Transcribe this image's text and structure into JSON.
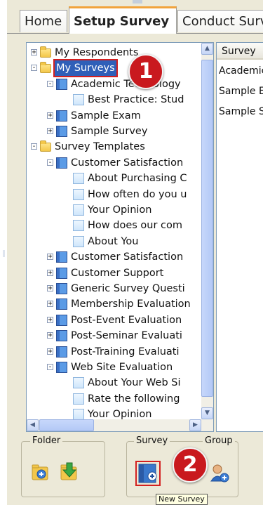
{
  "tabs": [
    {
      "label": "Home"
    },
    {
      "label": "Setup Survey"
    },
    {
      "label": "Conduct Surv"
    }
  ],
  "tree": {
    "nodes": [
      {
        "label": "My Respondents",
        "level": 0,
        "icon": "folder",
        "expander": "+"
      },
      {
        "label": "My Surveys",
        "level": 0,
        "icon": "folder",
        "expander": "-",
        "selected": true
      },
      {
        "label": "Academic Technology",
        "level": 1,
        "icon": "book",
        "expander": "-"
      },
      {
        "label": "Best Practice: Stud",
        "level": 2,
        "icon": "page",
        "expander": ""
      },
      {
        "label": "Sample Exam",
        "level": 1,
        "icon": "book",
        "expander": "+"
      },
      {
        "label": "Sample Survey",
        "level": 1,
        "icon": "book",
        "expander": "+"
      },
      {
        "label": "Survey Templates",
        "level": 0,
        "icon": "folder",
        "expander": "-"
      },
      {
        "label": "Customer Satisfaction",
        "level": 1,
        "icon": "book",
        "expander": "-"
      },
      {
        "label": "About Purchasing C",
        "level": 2,
        "icon": "page",
        "expander": ""
      },
      {
        "label": "How often do you u",
        "level": 2,
        "icon": "page",
        "expander": ""
      },
      {
        "label": "Your Opinion",
        "level": 2,
        "icon": "page",
        "expander": ""
      },
      {
        "label": "How does our com",
        "level": 2,
        "icon": "page",
        "expander": ""
      },
      {
        "label": "About You",
        "level": 2,
        "icon": "page",
        "expander": ""
      },
      {
        "label": "Customer Satisfaction",
        "level": 1,
        "icon": "book",
        "expander": "+"
      },
      {
        "label": "Customer Support",
        "level": 1,
        "icon": "book",
        "expander": "+"
      },
      {
        "label": "Generic Survey Questi",
        "level": 1,
        "icon": "book",
        "expander": "+"
      },
      {
        "label": "Membership Evaluation",
        "level": 1,
        "icon": "book",
        "expander": "+"
      },
      {
        "label": "Post-Event Evaluation",
        "level": 1,
        "icon": "book",
        "expander": "+"
      },
      {
        "label": "Post-Seminar Evaluati",
        "level": 1,
        "icon": "book",
        "expander": "+"
      },
      {
        "label": "Post-Training Evaluati",
        "level": 1,
        "icon": "book",
        "expander": "+"
      },
      {
        "label": "Web Site Evaluation",
        "level": 1,
        "icon": "book",
        "expander": "-"
      },
      {
        "label": "About Your Web Si",
        "level": 2,
        "icon": "page",
        "expander": ""
      },
      {
        "label": "Rate the following",
        "level": 2,
        "icon": "page",
        "expander": ""
      },
      {
        "label": "Your Opinion",
        "level": 2,
        "icon": "page",
        "expander": ""
      }
    ]
  },
  "list": {
    "header": "Survey",
    "rows": [
      "Academic",
      "Sample Ex",
      "Sample Su"
    ]
  },
  "toolbar": {
    "folder_group": "Folder",
    "survey_group": "Survey",
    "group_group": "Group"
  },
  "annotations": {
    "badge1": "1",
    "badge2": "2",
    "tooltip": "New Survey"
  },
  "colors": {
    "selection": "#2f5fb8",
    "badge": "#c9191e",
    "active_tab_accent": "#f1a33b"
  }
}
